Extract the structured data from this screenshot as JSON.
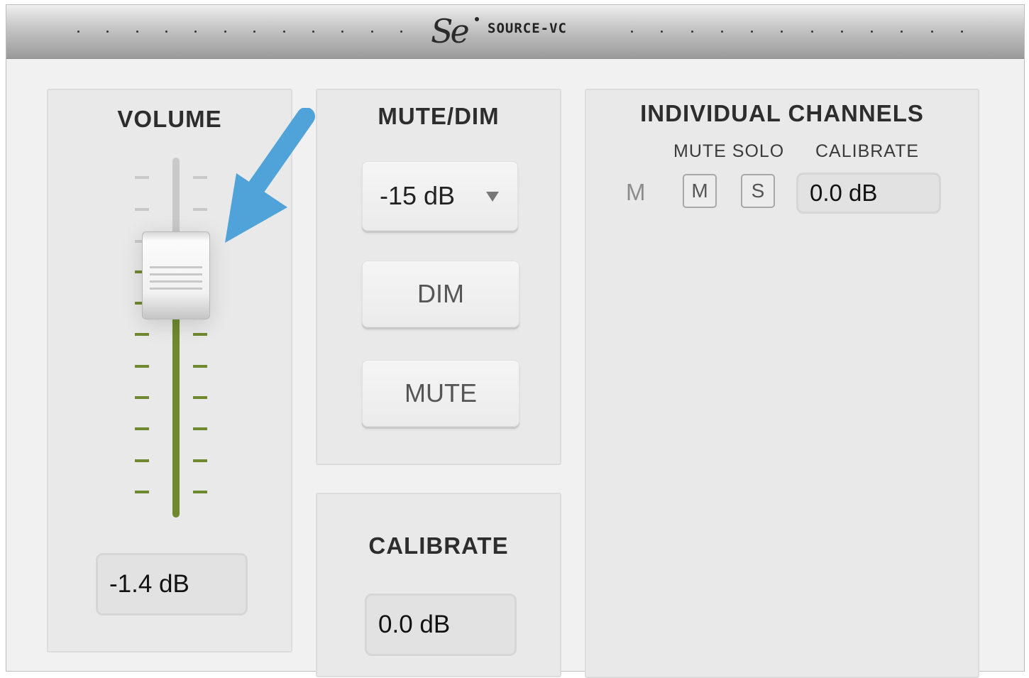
{
  "app": {
    "name": "SOURCE-VC",
    "logo_text": "Se"
  },
  "volume": {
    "title": "VOLUME",
    "readout": "-1.4 dB",
    "fader_level": 0.68
  },
  "mute_dim": {
    "title": "MUTE/DIM",
    "dim_level_select": "-15 dB",
    "dim_label": "DIM",
    "mute_label": "MUTE"
  },
  "calibrate": {
    "title": "CALIBRATE",
    "value": "0.0 dB"
  },
  "individual_channels": {
    "title": "INDIVIDUAL CHANNELS",
    "headers": {
      "mute_solo": "MUTE SOLO",
      "calibrate": "CALIBRATE"
    },
    "channels": [
      {
        "name": "M",
        "mute_label": "M",
        "solo_label": "S",
        "calibrate": "0.0 dB"
      }
    ]
  },
  "colors": {
    "accent_green": "#6f8a2e",
    "arrow_blue": "#4fa3d9"
  },
  "icons": [
    "dropdown-arrow-icon",
    "annotation-arrow-icon",
    "logo-icon"
  ]
}
